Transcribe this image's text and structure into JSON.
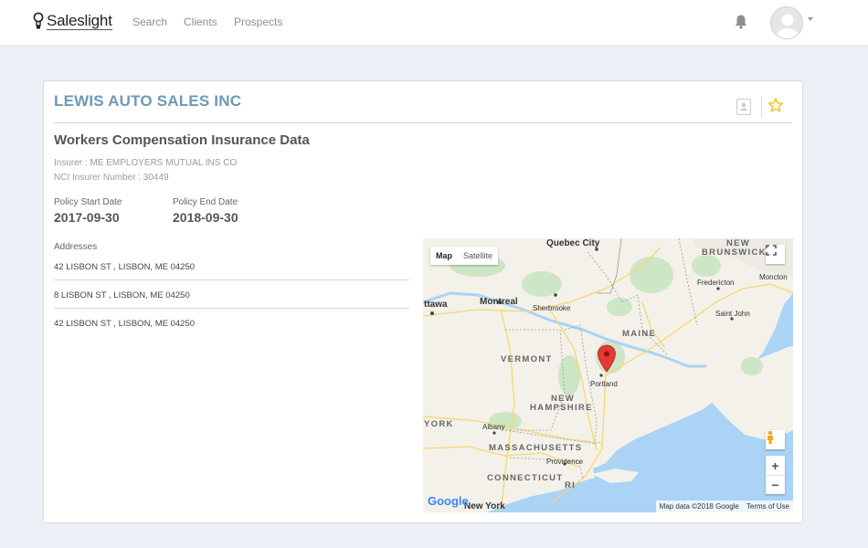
{
  "app": {
    "name": "Saleslight"
  },
  "nav": {
    "items": [
      "Search",
      "Clients",
      "Prospects"
    ]
  },
  "company": {
    "name": "LEWIS AUTO SALES INC"
  },
  "insurance": {
    "title": "Workers Compensation Insurance Data",
    "insurer": "Insurer : ME EMPLOYERS MUTUAL INS CO",
    "nci": "NCI Insurer Number : 30449",
    "start_label": "Policy Start Date",
    "start_value": "2017-09-30",
    "end_label": "Policy End Date",
    "end_value": "2018-09-30"
  },
  "addresses": {
    "label": "Addresses",
    "items": [
      "42 LISBON ST , LISBON, ME 04250",
      "8 LISBON ST , LISBON, ME 04250",
      "42 LISBON ST , LISBON, ME 04250"
    ]
  },
  "map": {
    "type_map": "Map",
    "type_satellite": "Satellite",
    "zoom_in": "+",
    "zoom_out": "−",
    "attribution": "Map data ©2018 Google",
    "terms": "Terms of Use",
    "google": "Google",
    "places": {
      "quebec": "Quebec City",
      "montreal": "Montreal",
      "ottawa": "ttawa",
      "sherbrooke": "Sherbrooke",
      "fredericton": "Fredericton",
      "moncton": "Moncton",
      "saintjohn": "Saint John",
      "portland": "Portland",
      "albany": "Albany",
      "providence": "Providence",
      "newyork": "New York"
    },
    "states": {
      "nb1": "NEW",
      "nb2": "BRUNSWICK",
      "maine": "MAINE",
      "vermont": "VERMONT",
      "nh1": "NEW",
      "nh2": "HAMPSHIRE",
      "york": "YORK",
      "mass": "MASSACHUSETTS",
      "conn": "CONNECTICUT",
      "ri": "RI"
    }
  },
  "colors": {
    "company_title": "#6e98b7",
    "star": "#f2c200",
    "marker": "#e53935",
    "water": "#aad3f5",
    "land": "#f3f1ea"
  }
}
